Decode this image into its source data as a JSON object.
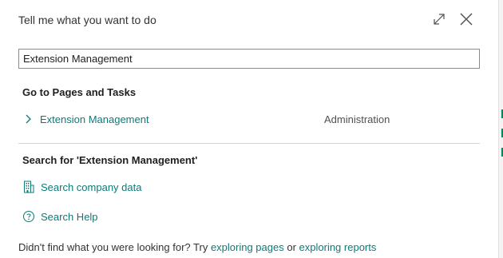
{
  "dialog": {
    "header": "Tell me what you want to do",
    "expand_icon": "expand-icon",
    "close_icon": "close-icon"
  },
  "search": {
    "value": "Extension Management"
  },
  "pages_section": {
    "title": "Go to Pages and Tasks",
    "results": [
      {
        "icon": "chevron-right-icon",
        "label": "Extension Management",
        "category": "Administration"
      }
    ]
  },
  "search_section": {
    "title": "Search for 'Extension Management'",
    "actions": [
      {
        "icon": "building-icon",
        "label": "Search company data"
      },
      {
        "icon": "help-circle-icon",
        "label": "Search Help"
      }
    ]
  },
  "footer": {
    "prefix": "Didn't find what you were looking for? Try ",
    "link1": "exploring pages",
    "middle": " or ",
    "link2": "exploring reports"
  },
  "colors": {
    "link": "#0e7a77",
    "accent_edge": "#00875a"
  }
}
